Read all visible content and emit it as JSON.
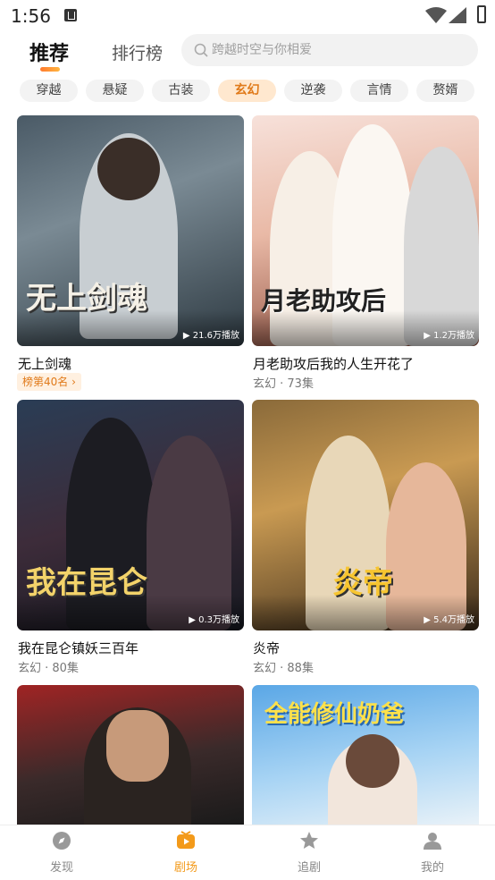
{
  "status": {
    "time": "1:56"
  },
  "topnav": {
    "tabs": [
      {
        "label": "推荐"
      },
      {
        "label": "排行榜"
      }
    ],
    "search_placeholder": "跨越时空与你相爱"
  },
  "categories": [
    {
      "label": "穿越"
    },
    {
      "label": "悬疑"
    },
    {
      "label": "古装"
    },
    {
      "label": "玄幻",
      "active": true
    },
    {
      "label": "逆袭"
    },
    {
      "label": "言情"
    },
    {
      "label": "赘婿"
    }
  ],
  "dramas": [
    {
      "title": "无上剑魂",
      "poster_text": "无上剑魂",
      "plays": "▶ 21.6万播放",
      "rank": "榜第40名 ›"
    },
    {
      "title": "月老助攻后我的人生开花了",
      "poster_text": "月老助攻后",
      "plays": "▶ 1.2万播放",
      "meta": "玄幻 · 73集"
    },
    {
      "title": "我在昆仑镇妖三百年",
      "poster_text": "我在昆仑",
      "plays": "▶ 0.3万播放",
      "meta": "玄幻 · 80集"
    },
    {
      "title": "炎帝",
      "poster_text": "炎帝",
      "plays": "▶ 5.4万播放",
      "meta": "玄幻 · 88集"
    },
    {
      "title": "",
      "poster_text": ""
    },
    {
      "title": "",
      "poster_text": "全能修仙奶爸"
    }
  ],
  "bottomnav": [
    {
      "label": "发现",
      "icon": "compass-icon"
    },
    {
      "label": "剧场",
      "icon": "tv-icon",
      "active": true
    },
    {
      "label": "追剧",
      "icon": "star-icon"
    },
    {
      "label": "我的",
      "icon": "user-icon"
    }
  ],
  "colors": {
    "accent": "#f39a1a",
    "chip_active_bg": "#ffe8cf"
  }
}
